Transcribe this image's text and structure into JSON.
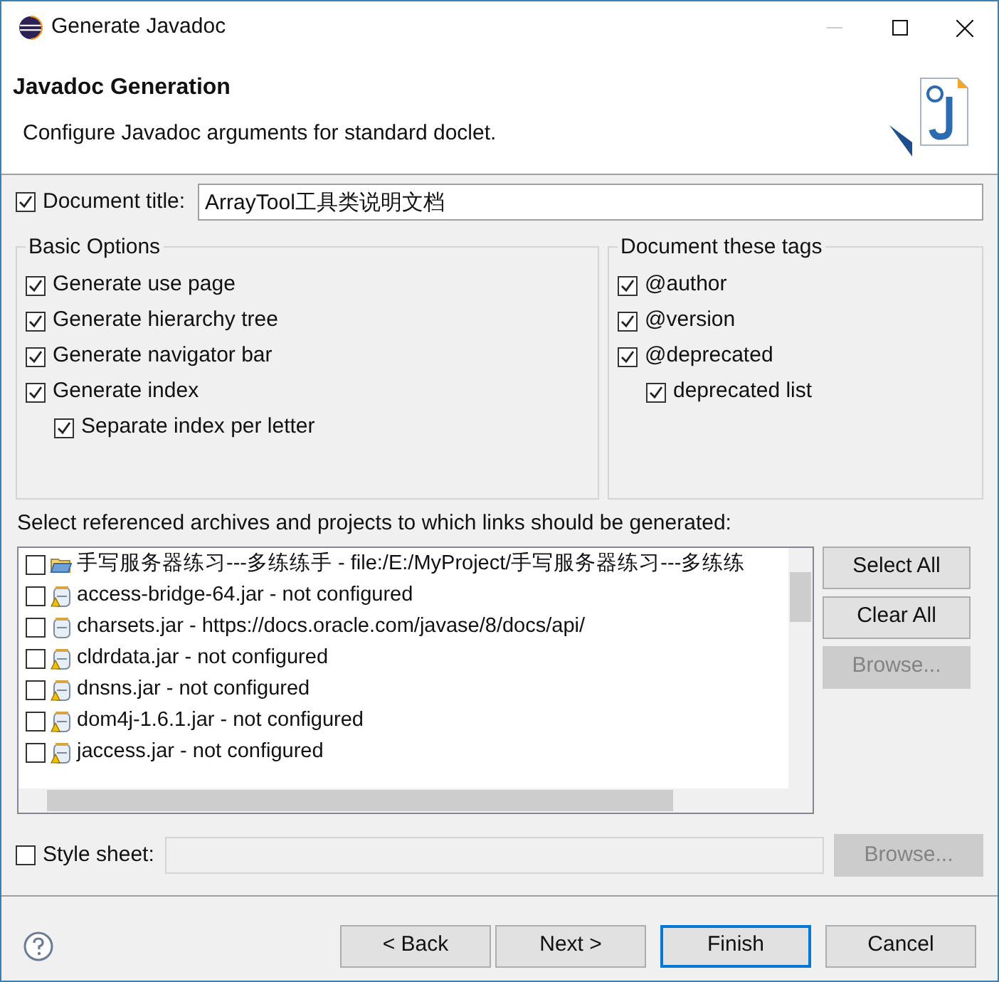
{
  "window": {
    "title": "Generate Javadoc"
  },
  "header": {
    "title": "Javadoc Generation",
    "description": "Configure Javadoc arguments for standard doclet."
  },
  "document_title": {
    "label": "Document title:",
    "checked": true,
    "value": "ArrayTool工具类说明文档"
  },
  "basic_options": {
    "title": "Basic Options",
    "items": [
      {
        "label": "Generate use page",
        "checked": true
      },
      {
        "label": "Generate hierarchy tree",
        "checked": true
      },
      {
        "label": "Generate navigator bar",
        "checked": true
      },
      {
        "label": "Generate index",
        "checked": true,
        "children": [
          {
            "label": "Separate index per letter",
            "checked": true
          }
        ]
      }
    ]
  },
  "tags": {
    "title": "Document these tags",
    "items": [
      {
        "label": "@author",
        "checked": true
      },
      {
        "label": "@version",
        "checked": true
      },
      {
        "label": "@deprecated",
        "checked": true,
        "children": [
          {
            "label": "deprecated list",
            "checked": true
          }
        ]
      }
    ]
  },
  "archives": {
    "label": "Select referenced archives and projects to which links should be generated:",
    "items": [
      {
        "kind": "project",
        "label": "手写服务器练习---多练练手 - file:/E:/MyProject/手写服务器练习---多练练",
        "checked": false
      },
      {
        "kind": "jar_warning",
        "label": "access-bridge-64.jar - not configured",
        "checked": false
      },
      {
        "kind": "jar",
        "label": "charsets.jar - https://docs.oracle.com/javase/8/docs/api/",
        "checked": false
      },
      {
        "kind": "jar_warning",
        "label": "cldrdata.jar - not configured",
        "checked": false
      },
      {
        "kind": "jar_warning",
        "label": "dnsns.jar - not configured",
        "checked": false
      },
      {
        "kind": "jar_warning",
        "label": "dom4j-1.6.1.jar - not configured",
        "checked": false
      },
      {
        "kind": "jar_warning",
        "label": "jaccess.jar - not configured",
        "checked": false
      }
    ],
    "buttons": [
      {
        "label": "Select All",
        "disabled": false
      },
      {
        "label": "Clear All",
        "disabled": false
      },
      {
        "label": "Browse...",
        "disabled": true
      }
    ]
  },
  "style_sheet": {
    "label": "Style sheet:",
    "checked": false,
    "browse": {
      "label": "Browse...",
      "disabled": true
    }
  },
  "footer": {
    "buttons": [
      {
        "label": "< Back",
        "default": false
      },
      {
        "label": "Next >",
        "default": false
      },
      {
        "label": "Finish",
        "default": true
      },
      {
        "label": "Cancel",
        "default": false
      }
    ]
  }
}
